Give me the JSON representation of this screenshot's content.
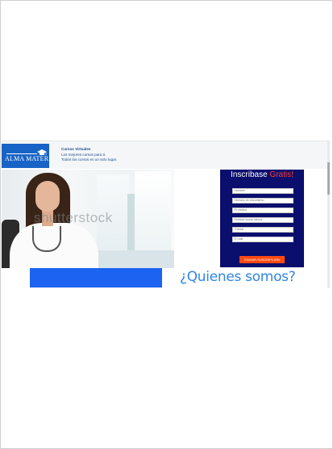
{
  "logo": {
    "text": "ALMA MATER",
    "icon": "graduation-cap-icon"
  },
  "header": {
    "title": "Cursos Virtuales",
    "line1": "Los mejores cursos para ti.",
    "line2": "Todos los cursos en un solo lugar."
  },
  "hero": {
    "watermark": "shutterstock",
    "image": "doctor-woman-photo"
  },
  "form": {
    "title_main": "Inscribase ",
    "title_accent": "Gratis!",
    "fields": [
      {
        "placeholder": "Nombre"
      },
      {
        "placeholder": "Número de documento"
      },
      {
        "placeholder": "Profesión"
      },
      {
        "placeholder": "Entidad donde labora"
      },
      {
        "placeholder": "Celular"
      },
      {
        "placeholder": "E-mail"
      }
    ],
    "submit_label": "ENVIAR SUSCRIPCION"
  },
  "about": {
    "heading": "¿Quienes somos?"
  },
  "colors": {
    "brand_blue": "#1763c6",
    "form_bg": "#0a0f6e",
    "accent_red": "#ff3b30",
    "submit_orange": "#ff4a12",
    "heading_blue": "#2f86e6",
    "bar_blue": "#1b63f0"
  }
}
